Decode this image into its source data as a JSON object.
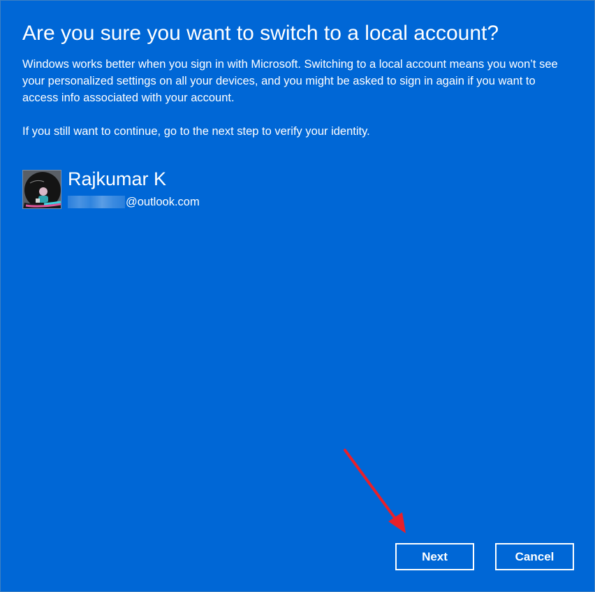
{
  "dialog": {
    "title": "Are you sure you want to switch to a local account?",
    "paragraph1": "Windows works better when you sign in with Microsoft. Switching to a local account means you won’t see your personalized settings on all your devices, and you might be asked to sign in again if you want to access info associated with your account.",
    "paragraph2": "If you still want to continue, go to the next step to verify your identity.",
    "background_color": "#0067d6"
  },
  "account": {
    "name": "Rajkumar K",
    "email_domain": "@outlook.com",
    "avatar_icon": "user-avatar-photo"
  },
  "buttons": {
    "next_label": "Next",
    "cancel_label": "Cancel"
  },
  "annotation": {
    "arrow_color": "#e8202a",
    "arrow_icon": "red-arrow-pointing-to-next"
  }
}
